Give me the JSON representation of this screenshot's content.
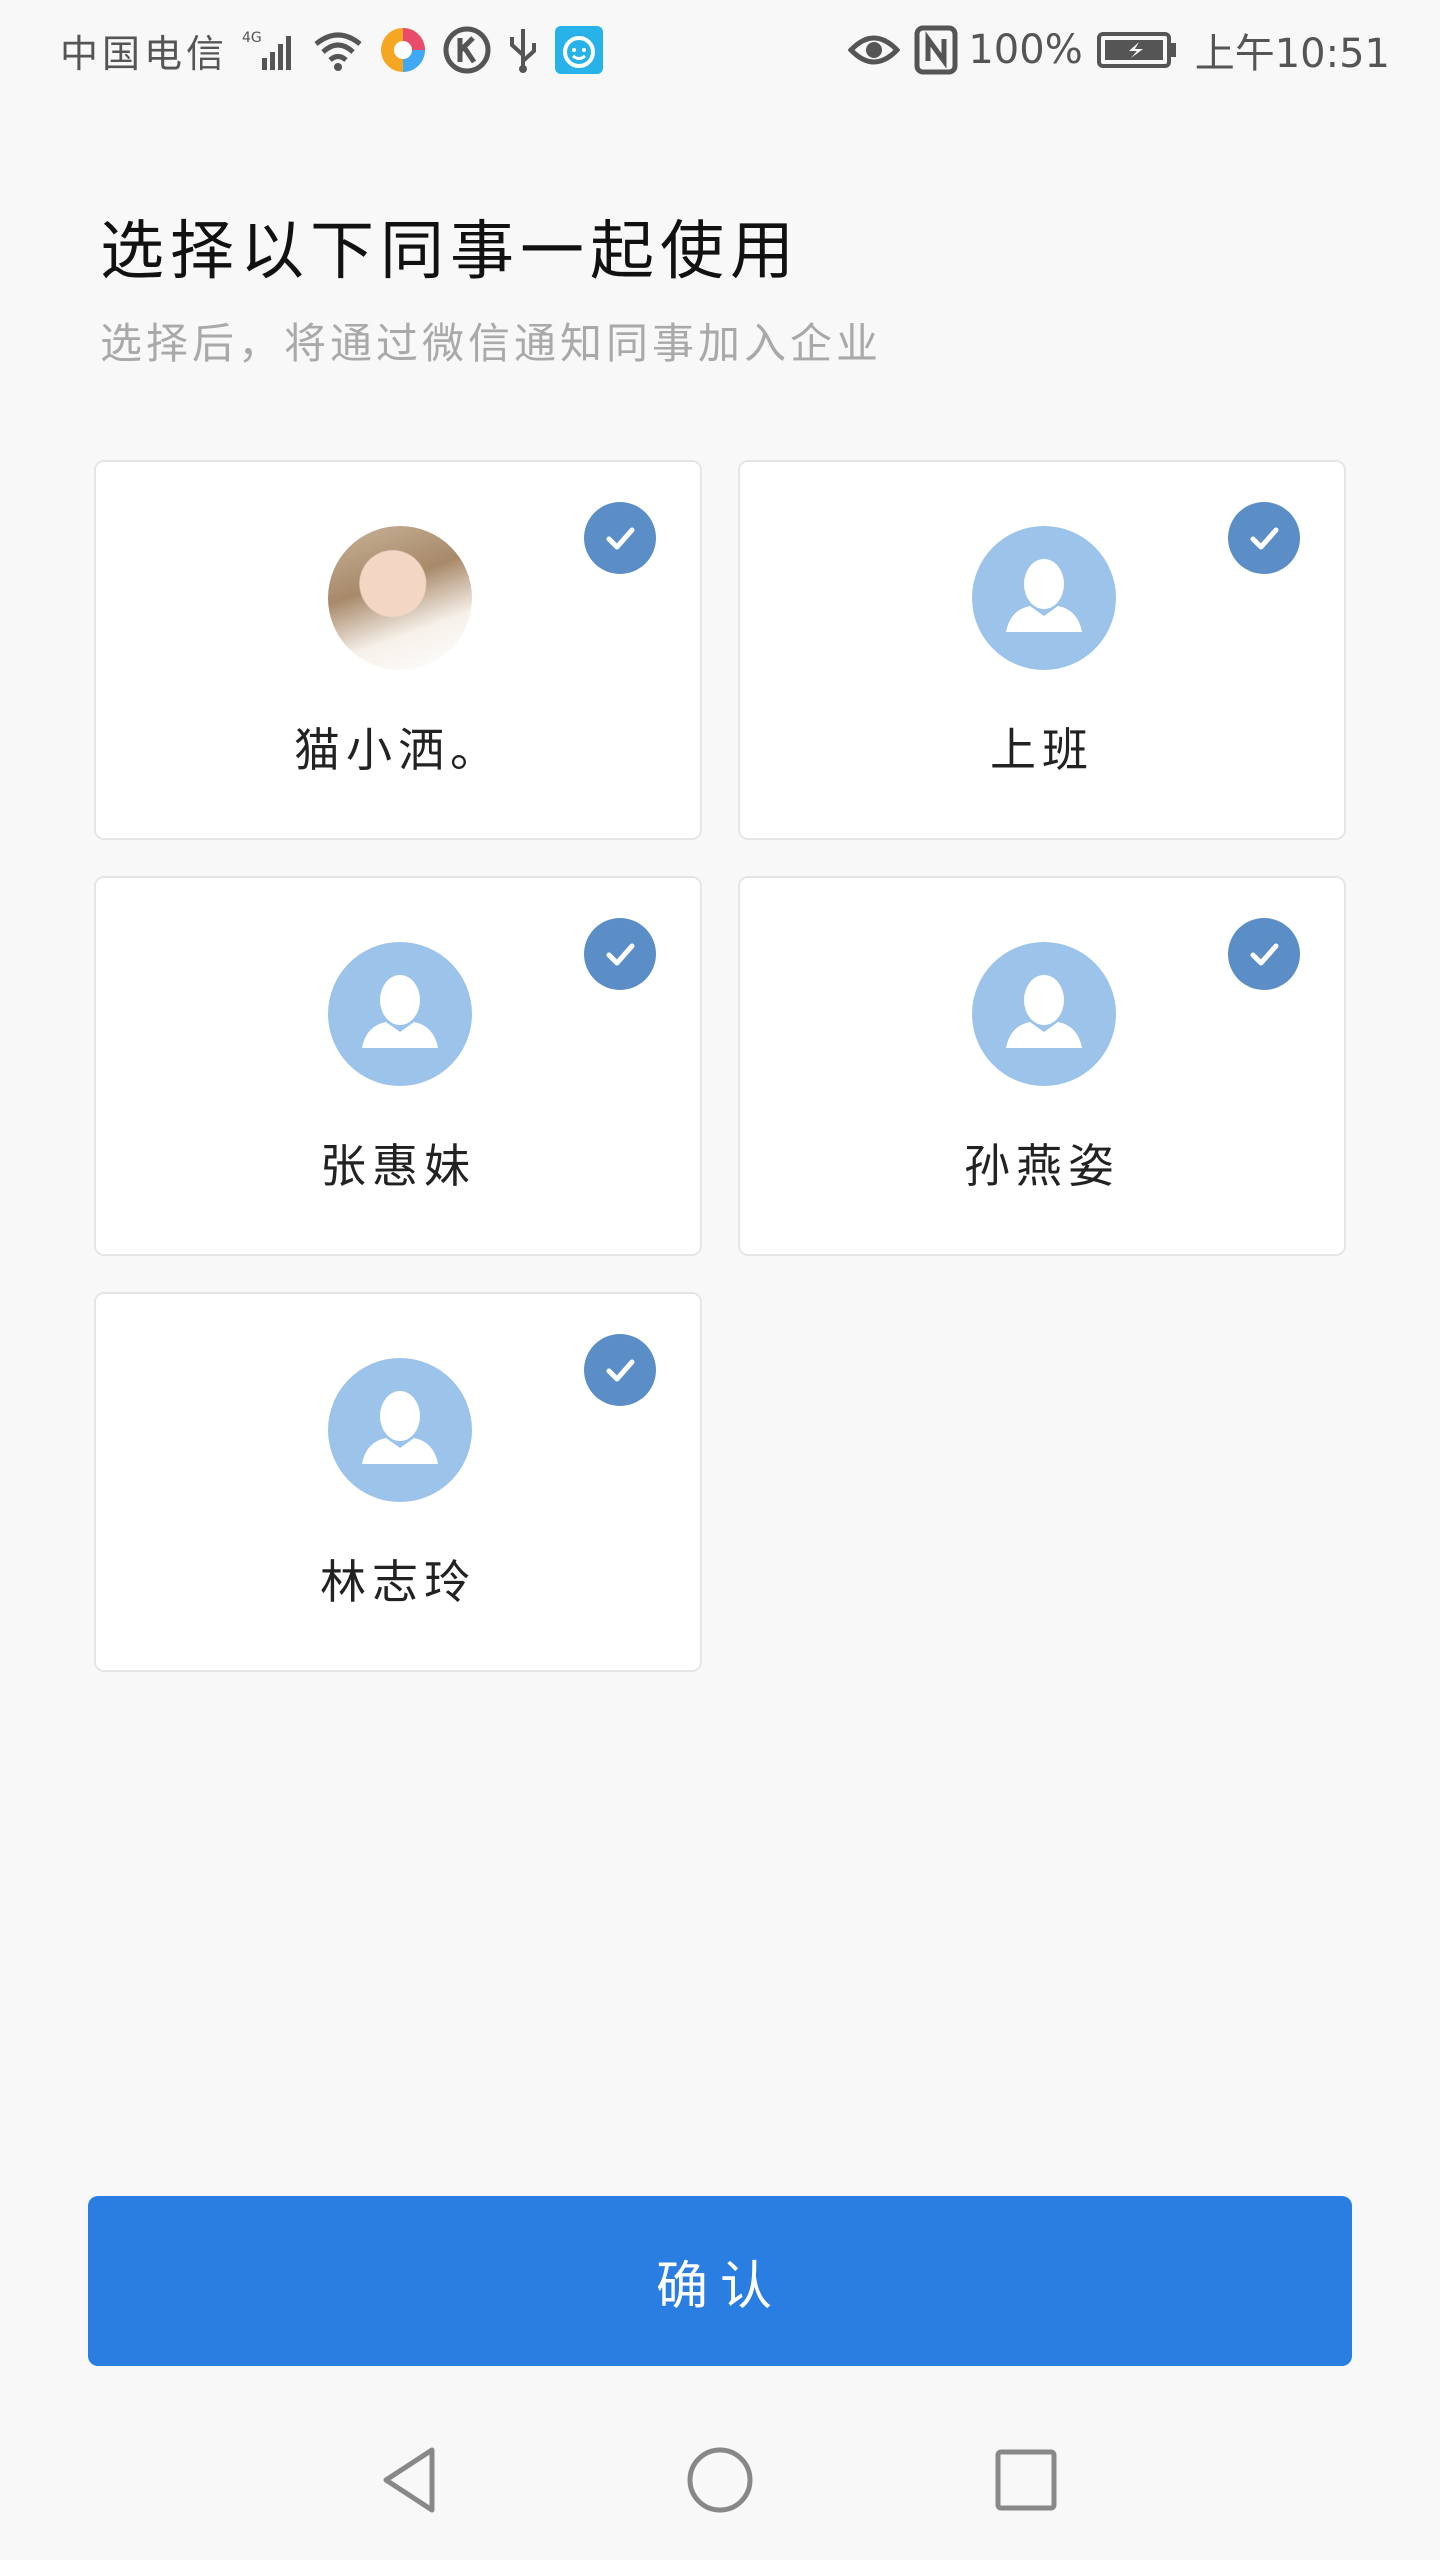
{
  "status_bar": {
    "carrier": "中国电信",
    "network": "4G",
    "battery_percent": "100%",
    "time": "上午10:51"
  },
  "page": {
    "title": "选择以下同事一起使用",
    "subtitle": "选择后，将通过微信通知同事加入企业"
  },
  "members": [
    {
      "name": "猫小洒。",
      "avatar": "photo",
      "selected": true
    },
    {
      "name": "上班",
      "avatar": "default-user-icon",
      "selected": true
    },
    {
      "name": "张惠妹",
      "avatar": "default-user-icon",
      "selected": true
    },
    {
      "name": "孙燕姿",
      "avatar": "default-user-icon",
      "selected": true
    },
    {
      "name": "林志玲",
      "avatar": "default-user-icon",
      "selected": true
    }
  ],
  "actions": {
    "confirm_label": "确认"
  },
  "nav": {
    "back": "back-triangle-icon",
    "home": "home-circle-icon",
    "recents": "recents-square-icon"
  },
  "colors": {
    "accent": "#2a7ee1",
    "check": "#5b8ec6",
    "avatar_default": "#9cc3ea",
    "background": "#f8f8f8"
  }
}
